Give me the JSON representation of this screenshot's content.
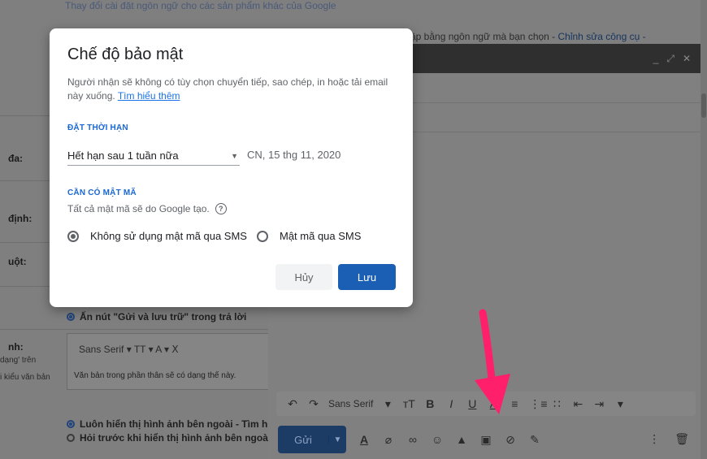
{
  "background": {
    "top_text": "Thay đổi cài đặt ngôn ngữ cho các sản phẩm khác của Google",
    "right_text": "ập bằng ngôn ngữ mà bạn chọn - ",
    "right_link": "Chỉnh sửa công cụ -",
    "labels": [
      "đa:",
      "định:",
      "uột:",
      "nh:"
    ],
    "small_lines": [
      "dạng' trên",
      "i kiểu văn bản"
    ],
    "send_archive": "Ấn nút \"Gửi và lưu trữ\" trong trả lời",
    "signature_toolbar": "Sans Serif  ▾  TT ▾  A ▾  Ⅹ",
    "signature_note": "Văn bản trong phần thân sẽ có dạng thế này.",
    "images_always": "Luôn hiển thị hình ảnh bên ngoài - Tìm h",
    "images_ask": "Hỏi trước khi hiển thị hình ảnh bên ngoà"
  },
  "compose": {
    "window_controls": [
      "_",
      "⤢",
      "✕"
    ],
    "format_font": "Sans Serif",
    "send_label": "Gửi"
  },
  "dialog": {
    "title": "Chế độ bảo mật",
    "description": "Người nhận sẽ không có tùy chọn chuyển tiếp, sao chép, in hoặc tải email này xuống. ",
    "learn_more": "Tìm hiểu thêm",
    "expiry_section": "ĐẶT THỜI HẠN",
    "expiry_value": "Hết hạn sau 1 tuần nữa",
    "expiry_date": "CN, 15 thg 11, 2020",
    "passcode_section": "CẦN CÓ MẬT MÃ",
    "passcode_note": "Tất cả mật mã sẽ do Google tạo.",
    "radio_no_sms": "Không sử dụng mật mã qua SMS",
    "radio_sms": "Mật mã qua SMS",
    "cancel_label": "Hủy",
    "save_label": "Lưu"
  },
  "colors": {
    "accent": "#1a5fb4",
    "link": "#1a73e8",
    "arrow": "#ff1f6b"
  }
}
